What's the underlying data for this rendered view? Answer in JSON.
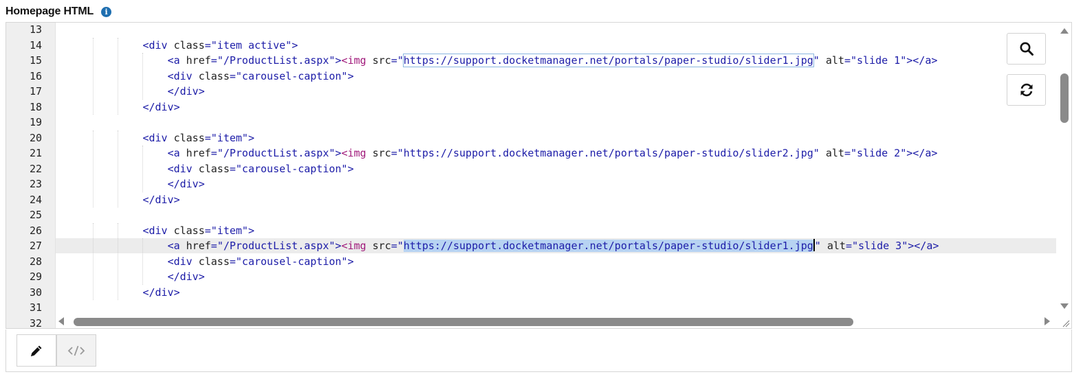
{
  "header": {
    "title": "Homepage HTML",
    "info_icon": "info-icon"
  },
  "editor": {
    "line_numbers": [
      "13",
      "14",
      "15",
      "16",
      "17",
      "18",
      "19",
      "20",
      "21",
      "22",
      "23",
      "24",
      "25",
      "26",
      "27",
      "28",
      "29",
      "30",
      "31",
      "32"
    ],
    "lines": [
      {
        "n": "13",
        "indent": 0,
        "segs": []
      },
      {
        "n": "14",
        "indent": 12,
        "segs": [
          [
            "t",
            "<div "
          ],
          [
            "a",
            "class"
          ],
          [
            "t",
            "="
          ],
          [
            "s",
            "\"item active\""
          ],
          [
            "t",
            ">"
          ]
        ]
      },
      {
        "n": "15",
        "indent": 16,
        "segs": [
          [
            "t",
            "<a "
          ],
          [
            "a",
            "href"
          ],
          [
            "t",
            "="
          ],
          [
            "s",
            "\"/ProductList.aspx\""
          ],
          [
            "t",
            ">"
          ],
          [
            "k",
            "<img "
          ],
          [
            "a",
            "src"
          ],
          [
            "t",
            "="
          ],
          [
            "s",
            "\""
          ],
          [
            "hl",
            "https://support.docketmanager.net/portals/paper-studio/slider1.jpg"
          ],
          [
            "s",
            "\""
          ],
          [
            "a",
            " alt"
          ],
          [
            "t",
            "="
          ],
          [
            "s",
            "\"slide 1\""
          ],
          [
            "t",
            "></a>"
          ]
        ]
      },
      {
        "n": "16",
        "indent": 16,
        "segs": [
          [
            "t",
            "<div "
          ],
          [
            "a",
            "class"
          ],
          [
            "t",
            "="
          ],
          [
            "s",
            "\"carousel-caption\""
          ],
          [
            "t",
            ">"
          ]
        ]
      },
      {
        "n": "17",
        "indent": 16,
        "segs": [
          [
            "t",
            "</div>"
          ]
        ]
      },
      {
        "n": "18",
        "indent": 12,
        "segs": [
          [
            "t",
            "</div>"
          ]
        ]
      },
      {
        "n": "19",
        "indent": 0,
        "segs": []
      },
      {
        "n": "20",
        "indent": 12,
        "segs": [
          [
            "t",
            "<div "
          ],
          [
            "a",
            "class"
          ],
          [
            "t",
            "="
          ],
          [
            "s",
            "\"item\""
          ],
          [
            "t",
            ">"
          ]
        ]
      },
      {
        "n": "21",
        "indent": 16,
        "segs": [
          [
            "t",
            "<a "
          ],
          [
            "a",
            "href"
          ],
          [
            "t",
            "="
          ],
          [
            "s",
            "\"/ProductList.aspx\""
          ],
          [
            "t",
            ">"
          ],
          [
            "k",
            "<img "
          ],
          [
            "a",
            "src"
          ],
          [
            "t",
            "="
          ],
          [
            "s",
            "\"https://support.docketmanager.net/portals/paper-studio/slider2.jpg\""
          ],
          [
            "a",
            " alt"
          ],
          [
            "t",
            "="
          ],
          [
            "s",
            "\"slide 2\""
          ],
          [
            "t",
            "></a>"
          ]
        ]
      },
      {
        "n": "22",
        "indent": 16,
        "segs": [
          [
            "t",
            "<div "
          ],
          [
            "a",
            "class"
          ],
          [
            "t",
            "="
          ],
          [
            "s",
            "\"carousel-caption\""
          ],
          [
            "t",
            ">"
          ]
        ]
      },
      {
        "n": "23",
        "indent": 16,
        "segs": [
          [
            "t",
            "</div>"
          ]
        ]
      },
      {
        "n": "24",
        "indent": 12,
        "segs": [
          [
            "t",
            "</div>"
          ]
        ]
      },
      {
        "n": "25",
        "indent": 0,
        "segs": []
      },
      {
        "n": "26",
        "indent": 12,
        "segs": [
          [
            "t",
            "<div "
          ],
          [
            "a",
            "class"
          ],
          [
            "t",
            "="
          ],
          [
            "s",
            "\"item\""
          ],
          [
            "t",
            ">"
          ]
        ]
      },
      {
        "n": "27",
        "indent": 16,
        "active": true,
        "segs": [
          [
            "t",
            "<a "
          ],
          [
            "a",
            "href"
          ],
          [
            "t",
            "="
          ],
          [
            "s",
            "\"/ProductList.aspx\""
          ],
          [
            "t",
            ">"
          ],
          [
            "k",
            "<img "
          ],
          [
            "a",
            "src"
          ],
          [
            "t",
            "="
          ],
          [
            "s",
            "\""
          ],
          [
            "sel",
            "https://support.docketmanager.net/portals/paper-studio/slider1.jpg"
          ],
          [
            "cursor",
            ""
          ],
          [
            "s",
            "\""
          ],
          [
            "a",
            " alt"
          ],
          [
            "t",
            "="
          ],
          [
            "s",
            "\"slide 3\""
          ],
          [
            "t",
            "></a>"
          ]
        ]
      },
      {
        "n": "28",
        "indent": 16,
        "segs": [
          [
            "t",
            "<div "
          ],
          [
            "a",
            "class"
          ],
          [
            "t",
            "="
          ],
          [
            "s",
            "\"carousel-caption\""
          ],
          [
            "t",
            ">"
          ]
        ]
      },
      {
        "n": "29",
        "indent": 16,
        "segs": [
          [
            "t",
            "</div>"
          ]
        ]
      },
      {
        "n": "30",
        "indent": 12,
        "segs": [
          [
            "t",
            "</div>"
          ]
        ]
      },
      {
        "n": "31",
        "indent": 0,
        "segs": []
      },
      {
        "n": "32",
        "indent": 0,
        "segs": []
      }
    ]
  },
  "side_buttons": {
    "search": "search-icon",
    "refresh": "refresh-icon"
  },
  "toolbar": {
    "edit": "pencil-icon",
    "source": "code-icon"
  },
  "colors": {
    "tag": "#1a1aa6",
    "attr": "#222222",
    "string": "#1c1ca8",
    "img_tag": "#a0197a",
    "selection": "#b7d3f2",
    "info": "#1f6fb0"
  }
}
